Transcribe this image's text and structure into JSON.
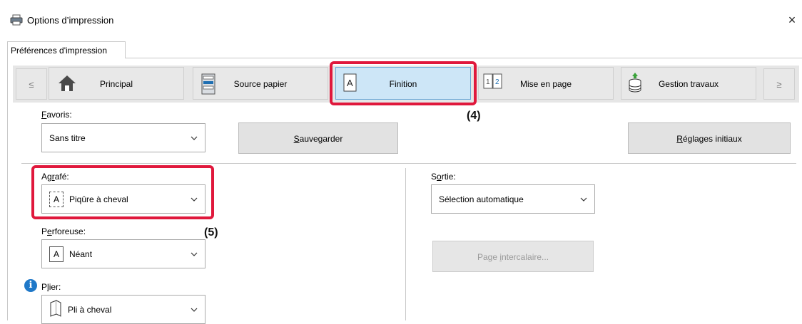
{
  "window": {
    "title": "Options d’impression",
    "close_glyph": "×",
    "icon": "printer-icon"
  },
  "tabs": [
    {
      "label": "Préférences d'impression"
    }
  ],
  "nav": {
    "prev_glyph": "≤",
    "next_glyph": "≥",
    "items": [
      {
        "label": "Principal",
        "icon": "home-icon"
      },
      {
        "label": "Source papier",
        "icon": "paper-tray-icon"
      },
      {
        "label": "Finition",
        "icon": "finishing-icon",
        "active": true
      },
      {
        "label": "Mise en page",
        "icon": "layout-icon",
        "icon_text": "1 2"
      },
      {
        "label": "Gestion travaux",
        "icon": "job-storage-icon"
      }
    ]
  },
  "callouts": {
    "c4": "(4)",
    "c5": "(5)"
  },
  "favorites": {
    "label_first": "F",
    "label_rest": "avoris:",
    "value": "Sans titre",
    "save_first": "S",
    "save_rest": "auvegarder",
    "reset_first": "R",
    "reset_rest": "églages initiaux"
  },
  "staple": {
    "label_a": "Ag",
    "label_u": "r",
    "label_b": "afé:",
    "icon_text": "A",
    "value": "Piqûre à cheval"
  },
  "punch": {
    "label_a": "P",
    "label_u": "e",
    "label_b": "rforeuse:",
    "icon_text": "A",
    "value": "Néant"
  },
  "fold": {
    "label_a": "P",
    "label_u": "l",
    "label_b": "ier:",
    "value": "Pli à cheval",
    "info_glyph": "i"
  },
  "output": {
    "label_a": "S",
    "label_u": "o",
    "label_b": "rtie:",
    "value": "Sélection automatique"
  },
  "insert_page": {
    "label_a": "Page ",
    "label_u": "i",
    "label_b": "ntercalaire..."
  },
  "colors": {
    "highlight": "#e0183c",
    "active_tab": "#cde6f7",
    "info": "#1f78c8"
  }
}
